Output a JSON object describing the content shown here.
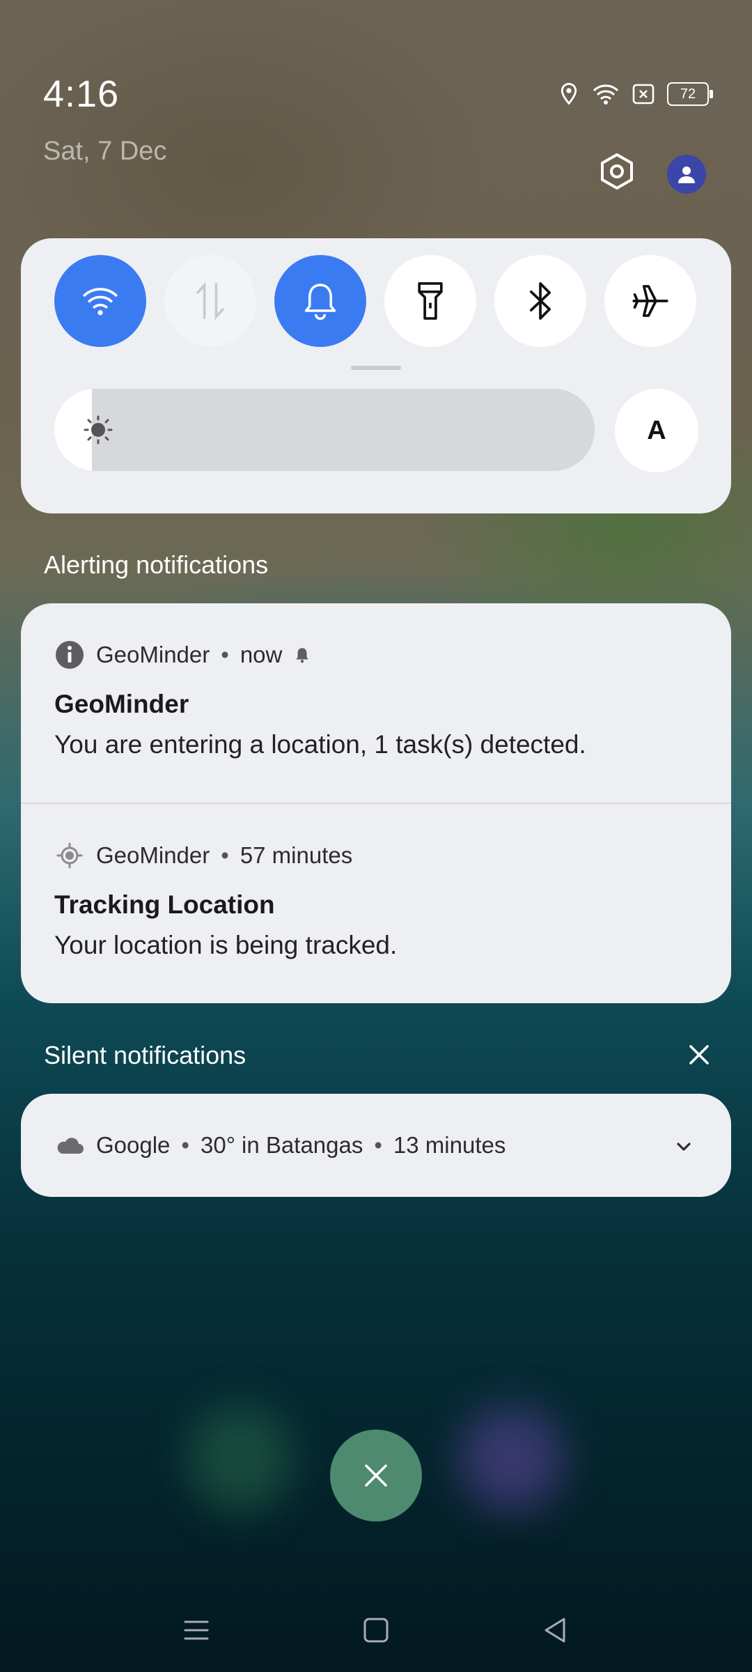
{
  "status_bar": {
    "time": "4:16",
    "date": "Sat, 7 Dec",
    "battery": "72",
    "icons": [
      "location-icon",
      "wifi-icon",
      "no-sim-icon",
      "battery-icon"
    ]
  },
  "header_actions": [
    "settings-gear-icon",
    "user-avatar-icon"
  ],
  "quick_settings": {
    "tiles": [
      {
        "name": "wifi",
        "icon": "wifi-icon",
        "active": true
      },
      {
        "name": "mobile-data",
        "icon": "data-arrows-icon",
        "active": false
      },
      {
        "name": "sound",
        "icon": "bell-icon",
        "active": true
      },
      {
        "name": "flashlight",
        "icon": "flashlight-icon",
        "active": false
      },
      {
        "name": "bluetooth",
        "icon": "bluetooth-icon",
        "active": false
      },
      {
        "name": "airplane-mode",
        "icon": "airplane-icon",
        "active": false
      }
    ],
    "brightness_level": 0.07,
    "auto_brightness_label": "A"
  },
  "alerting": {
    "title": "Alerting notifications",
    "notifications": [
      {
        "app": "GeoMinder",
        "time": "now",
        "icon": "info-icon",
        "title": "GeoMinder",
        "body": "You are entering a location, 1 task(s) detected."
      },
      {
        "app": "GeoMinder",
        "time": "57 minutes",
        "icon": "gps-icon",
        "title": "Tracking Location",
        "body": "Your location is being tracked."
      }
    ]
  },
  "silent": {
    "title": "Silent notifications",
    "notification": {
      "app": "Google",
      "detail": "30° in Batangas",
      "time": "13 minutes",
      "icon": "cloud-icon"
    }
  },
  "colors": {
    "accent": "#3a7bf2",
    "panel": "#eeeff3",
    "fab": "#4d8a70"
  }
}
